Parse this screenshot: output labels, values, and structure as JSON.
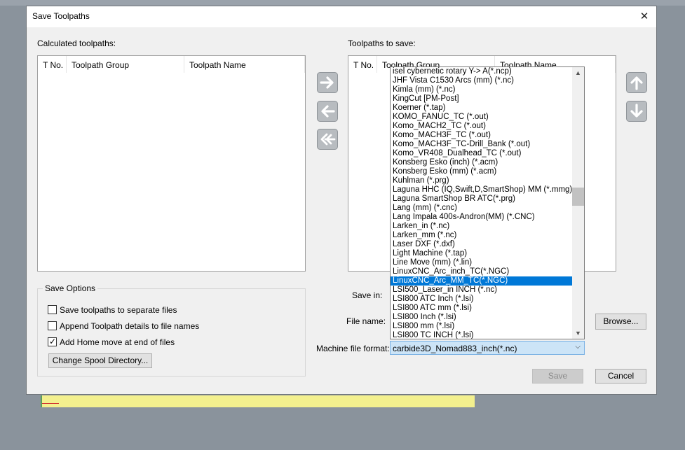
{
  "dialog": {
    "title": "Save Toolpaths"
  },
  "left": {
    "label": "Calculated toolpaths:",
    "columns": [
      "T No.",
      "Toolpath Group",
      "Toolpath Name"
    ]
  },
  "right": {
    "label": "Toolpaths to save:",
    "columns": [
      "T No.",
      "Toolpath Group",
      "Toolpath Name"
    ]
  },
  "icons": {
    "add": "arrow-right-icon",
    "remove": "arrow-left-icon",
    "remove_all": "double-arrow-left-icon",
    "up": "arrow-up-icon",
    "down": "arrow-down-icon"
  },
  "save_options": {
    "title": "Save Options",
    "items": [
      {
        "label": "Save toolpaths to separate files",
        "checked": false
      },
      {
        "label": "Append Toolpath details to file names",
        "checked": false
      },
      {
        "label": "Add Home move at end of files",
        "checked": true
      }
    ],
    "spool_button": "Change Spool Directory..."
  },
  "fields": {
    "save_in": "Save in:",
    "file_name": "File name:",
    "format_label": "Machine file format:",
    "format_value": "carbide3D_Nomad883_inch(*.nc)"
  },
  "buttons": {
    "browse": "Browse...",
    "save": "Save",
    "cancel": "Cancel"
  },
  "formats": [
    "isel cybernetic rotary Y-> A(*.ncp)",
    "JHF Vista C1530 Arcs (mm) (*.nc)",
    "Kimla (mm) (*.nc)",
    "KingCut [PM-Post]",
    "Koerner (*.tap)",
    "KOMO_FANUC_TC (*.out)",
    "Komo_MACH2_TC (*.out)",
    "Komo_MACH3F_TC (*.out)",
    "Komo_MACH3F_TC-Drill_Bank (*.out)",
    "Komo_VR408_Dualhead_TC (*.out)",
    "Konsberg Esko (inch) (*.acm)",
    "Konsberg Esko (mm) (*.acm)",
    "Kuhlman (*.prg)",
    "Laguna HHC (IQ,Swift,D,SmartShop) MM (*.mmg)",
    "Laguna SmartShop BR ATC(*.prg)",
    "Lang (mm) (*.cnc)",
    "Lang Impala 400s-Andron(MM) (*.CNC)",
    "Larken_in (*.nc)",
    "Larken_mm (*.nc)",
    "Laser DXF (*.dxf)",
    "Light Machine (*.tap)",
    "Line Move (mm) (*.lin)",
    "LinuxCNC_Arc_inch_TC(*.NGC)",
    "LinuxCNC_Arc_MM_TC(*.NGC)",
    "LSI500_Laser_in INCH (*.nc)",
    "LSI800 ATC Inch (*.lsi)",
    "LSI800 ATC mm (*.lsi)",
    "LSI800 Inch (*.lsi)",
    "LSI800 mm (*.lsi)",
    "LSI800 TC INCH (*.lsi)"
  ],
  "selected_format_index": 23,
  "colors": {
    "selection": "#0078d7",
    "combo_bg": "#cce4f7",
    "canvas_yellow": "#f3f08e"
  }
}
